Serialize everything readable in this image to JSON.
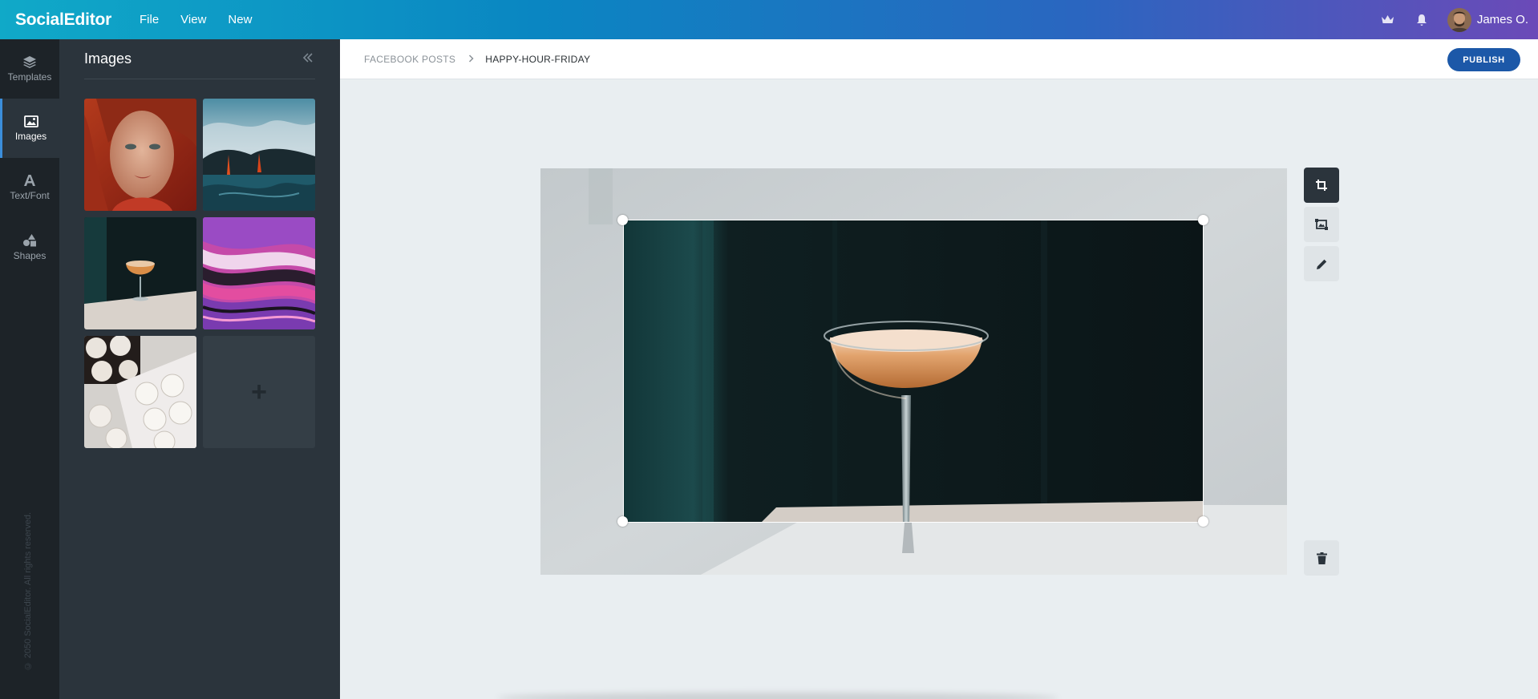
{
  "app": {
    "brand": "SocialEditor",
    "menu": [
      "File",
      "View",
      "New"
    ],
    "user_name": "James O."
  },
  "rail": {
    "items": [
      {
        "label": "Templates",
        "icon": "layers-icon"
      },
      {
        "label": "Images",
        "icon": "image-icon",
        "active": true
      },
      {
        "label": "Text/Font",
        "icon": "text-icon"
      },
      {
        "label": "Shapes",
        "icon": "shapes-icon"
      }
    ],
    "copyright": "© 2050 SocialEditor. All rights reserved."
  },
  "panel": {
    "title": "Images",
    "collapse_icon": "double-chevron-left-icon",
    "add_icon": "+",
    "thumbnails": [
      "woman-portrait",
      "lava-ocean",
      "cocktail-glass",
      "pink-marble",
      "meringues"
    ]
  },
  "breadcrumb": {
    "parent": "FACEBOOK POSTS",
    "current": "HAPPY-HOUR-FRIDAY"
  },
  "actions": {
    "publish_label": "PUBLISH"
  },
  "tools": [
    {
      "name": "crop-icon",
      "active": true
    },
    {
      "name": "replace-image-icon",
      "active": false
    },
    {
      "name": "edit-pencil-icon",
      "active": false
    },
    {
      "name": "trash-icon",
      "active": false
    }
  ],
  "colors": {
    "accent": "#1c58a8",
    "rail_bg": "#1d2328",
    "panel_bg": "#2b343c",
    "workspace_bg": "#e9eef1"
  }
}
